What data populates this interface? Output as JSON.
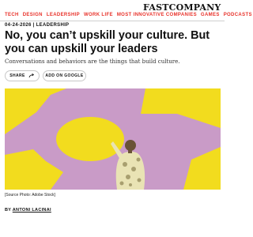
{
  "nav": {
    "items": [
      "TECH",
      "DESIGN",
      "LEADERSHIP",
      "WORK LIFE",
      "MOST INNOVATIVE COMPANIES",
      "GAMES",
      "PODCASTS"
    ],
    "separator": "|",
    "logo": "FASTCOMPANY"
  },
  "article": {
    "date": "04-24-2026",
    "category": "LEADERSHIP",
    "headline": "No, you can’t upskill your culture. But you can upskill your leaders",
    "subhead": "Conversations and behaviors are the things that build culture.",
    "share_label": "SHARE",
    "google_label": "ADD ON GOOGLE",
    "caption": "[Source Photo: Adobe Stock]",
    "byline_prefix": "BY",
    "author": "ANTONI LACINAI"
  },
  "colors": {
    "accent": "#e8322a",
    "hero_pink": "#c99bc7",
    "hero_yellow": "#f2dc1e"
  }
}
